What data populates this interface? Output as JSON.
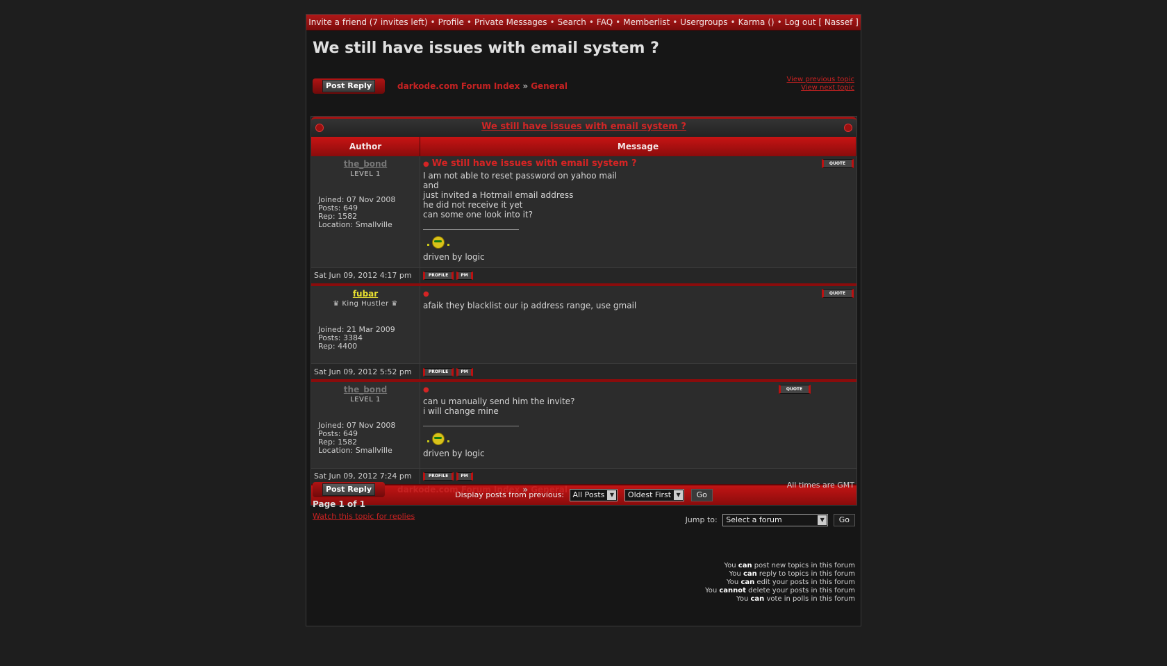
{
  "topnav": {
    "items": [
      "Invite a friend (7 invites left)",
      "Profile",
      "Private Messages",
      "Search",
      "FAQ",
      "Memberlist",
      "Usergroups",
      "Karma ()",
      "Log out [ Nassef ]"
    ],
    "separator": "•"
  },
  "page_title": "We still have issues with email system ?",
  "post_reply_label": "Post Reply",
  "breadcrumb": {
    "index": "darkode.com Forum Index",
    "arrow": "»",
    "forum": "General"
  },
  "nav": {
    "prev": "View previous topic",
    "next": "View next topic"
  },
  "topic_header": "We still have issues with email system ?",
  "columns": {
    "author": "Author",
    "message": "Message"
  },
  "posts": [
    {
      "author": "the_bond",
      "rank": "LEVEL 1",
      "joined": "Joined: 07 Nov 2008",
      "posts": "Posts: 649",
      "rep": "Rep: 1582",
      "location": "Location: Smallville",
      "subject": "We still have issues with email system ?",
      "lines": [
        "I am not able to reset password on yahoo mail",
        "and",
        "just invited a Hotmail email address",
        "he did not receive it yet",
        "can some one look into it?"
      ],
      "signature": "driven by logic",
      "date": "Sat Jun 09, 2012 4:17 pm"
    },
    {
      "author": "fubar",
      "rank": "♛ King Hustler ♛",
      "joined": "Joined: 21 Mar 2009",
      "posts": "Posts: 3384",
      "rep": "Rep: 4400",
      "lines": [
        "afaik they blacklist our ip address range, use gmail"
      ],
      "date": "Sat Jun 09, 2012 5:52 pm"
    },
    {
      "author": "the_bond",
      "rank": "LEVEL 1",
      "joined": "Joined: 07 Nov 2008",
      "posts": "Posts: 649",
      "rep": "Rep: 1582",
      "location": "Location: Smallville",
      "lines": [
        "can u manually send him the invite?",
        "i will change mine"
      ],
      "signature": "driven by logic",
      "date": "Sat Jun 09, 2012 7:24 pm"
    }
  ],
  "buttons": {
    "quote": "QUOTE",
    "profile": "PROFILE",
    "pm": "PM",
    "go": "Go"
  },
  "display": {
    "label": "Display posts from previous:",
    "range": "All Posts",
    "order": "Oldest First"
  },
  "timezone": "All times are GMT",
  "pagination": "Page 1 of 1",
  "watch": "Watch this topic for replies",
  "jump": {
    "label": "Jump to:",
    "placeholder": "Select a forum"
  },
  "permissions": [
    {
      "pre": "You ",
      "verb": "can",
      "post": " post new topics in this forum"
    },
    {
      "pre": "You ",
      "verb": "can",
      "post": " reply to topics in this forum"
    },
    {
      "pre": "You ",
      "verb": "can",
      "post": " edit your posts in this forum"
    },
    {
      "pre": "You ",
      "verb": "cannot",
      "post": " delete your posts in this forum"
    },
    {
      "pre": "You ",
      "verb": "can",
      "post": " vote in polls in this forum"
    }
  ],
  "colors": {
    "accent": "#c62222",
    "member_name": "#777777",
    "mod_name": "#e8e030",
    "background": "#1e1e1e"
  }
}
